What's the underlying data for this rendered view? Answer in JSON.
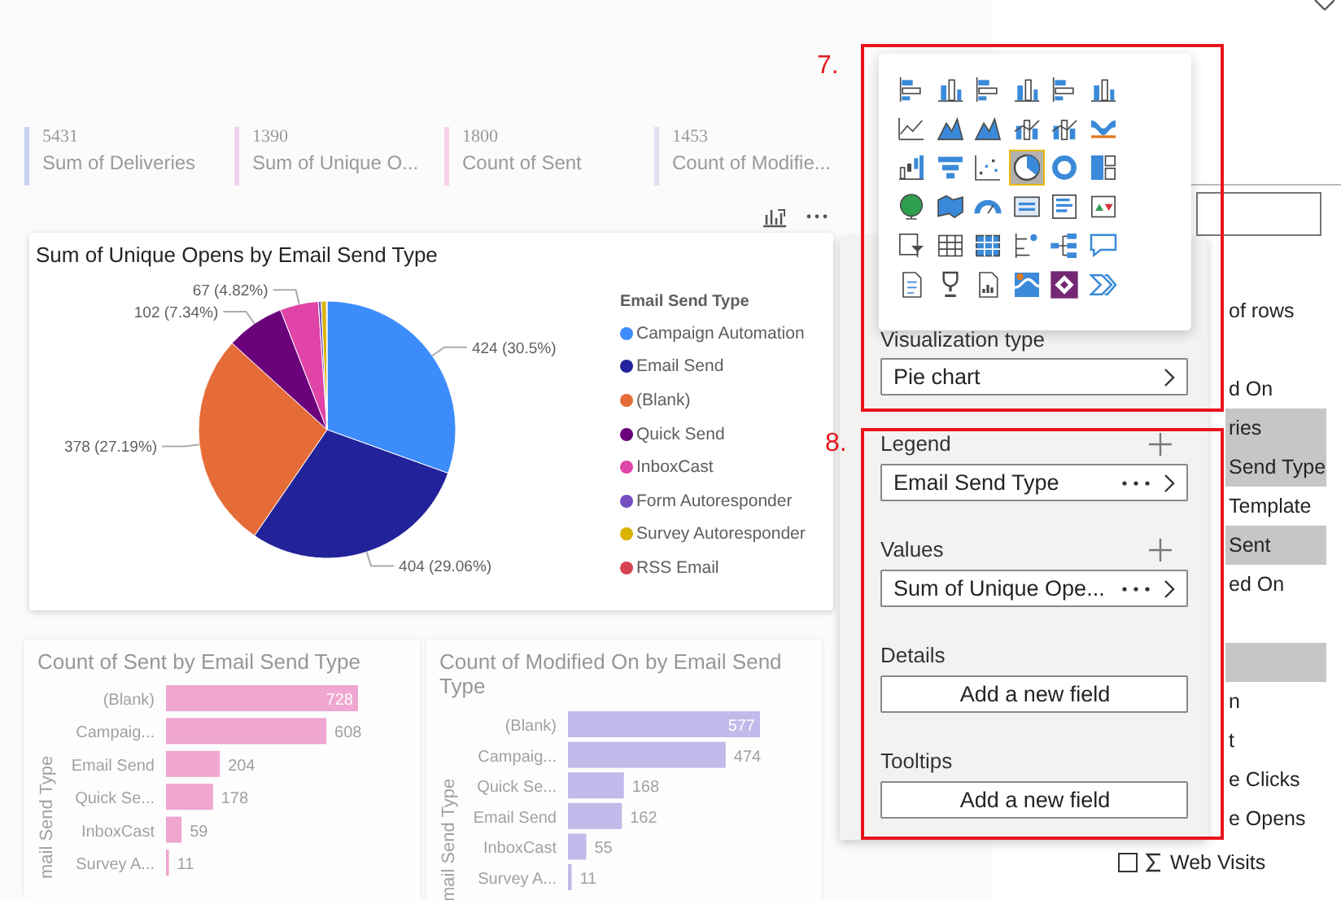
{
  "kpi_cards": [
    {
      "value": "5431",
      "label": "Sum of Deliveries",
      "color": "#c9d0f2"
    },
    {
      "value": "1390",
      "label": "Sum of Unique O...",
      "color": "#eed3ee"
    },
    {
      "value": "1800",
      "label": "Count of Sent",
      "color": "#f7d2e6"
    },
    {
      "value": "1453",
      "label": "Count of Modifie...",
      "color": "#e2def4"
    }
  ],
  "pie_card": {
    "title": "Sum of Unique Opens by Email Send Type",
    "legend_title": "Email Send Type",
    "legend": [
      {
        "label": "Campaign Automation",
        "color": "#3c8cfc"
      },
      {
        "label": "Email Send",
        "color": "#22239a"
      },
      {
        "label": "(Blank)",
        "color": "#e66c37"
      },
      {
        "label": "Quick Send",
        "color": "#6b007b"
      },
      {
        "label": "InboxCast",
        "color": "#e044a7"
      },
      {
        "label": "Form Autoresponder",
        "color": "#744ec2"
      },
      {
        "label": "Survey Autoresponder",
        "color": "#d9b300"
      },
      {
        "label": "RSS Email",
        "color": "#d64550"
      }
    ],
    "chart_data": {
      "type": "pie",
      "series": [
        {
          "values": [
            30.5,
            29.06,
            27.19,
            7.34,
            4.82,
            0.36,
            0.65,
            0.08
          ]
        }
      ],
      "value_labels": [
        "424 (30.5%)",
        "404 (29.06%)",
        "378 (27.19%)",
        "102 (7.34%)",
        "67 (4.82%)",
        null,
        null,
        null
      ]
    }
  },
  "bar_cards": [
    {
      "title": "Count of Sent by Email Send Type",
      "chart_data": {
        "type": "bar",
        "orientation": "horizontal",
        "ylabel": "mail Send Type",
        "categories": [
          "(Blank)",
          "Campaig...",
          "Email Send",
          "Quick Se...",
          "InboxCast",
          "Survey A..."
        ],
        "series": [
          {
            "color": "#e86fb4",
            "values": [
              728,
              608,
              204,
              178,
              59,
              11
            ]
          }
        ],
        "data_labels": true
      }
    },
    {
      "title": "Count of Modified On by Email Send Type",
      "chart_data": {
        "type": "bar",
        "orientation": "horizontal",
        "ylabel": "mail Send Type",
        "categories": [
          "(Blank)",
          "Campaig...",
          "Quick Se...",
          "Email Send",
          "InboxCast",
          "Survey A..."
        ],
        "series": [
          {
            "color": "#9d8fe0",
            "values": [
              577,
              474,
              168,
              162,
              55,
              11
            ]
          }
        ],
        "data_labels": true
      }
    }
  ],
  "field_list": [
    {
      "label": "of rows",
      "selected": false,
      "kind": "partial"
    },
    {
      "label": "d On",
      "selected": false,
      "kind": "partial"
    },
    {
      "label": "ries",
      "selected": true,
      "kind": "partial"
    },
    {
      "label": "Send Type",
      "selected": true,
      "kind": "partial"
    },
    {
      "label": "Template",
      "selected": false,
      "kind": "partial"
    },
    {
      "label": "Sent",
      "selected": true,
      "kind": "partial"
    },
    {
      "label": "ed On",
      "selected": false,
      "kind": "partial"
    },
    {
      "selected": true,
      "kind": "partial"
    },
    {
      "label": "n",
      "selected": false,
      "kind": "partial"
    },
    {
      "label": "t",
      "selected": false,
      "kind": "partial"
    },
    {
      "label": "e Clicks",
      "selected": false,
      "kind": "partial"
    },
    {
      "label": "e Opens",
      "selected": false,
      "kind": "partial"
    },
    {
      "label": "Web Visits",
      "selected": false,
      "kind": "measure"
    }
  ],
  "visual_types": [
    {
      "kind": "stacked-bar",
      "selected": false
    },
    {
      "kind": "stacked-column",
      "selected": false
    },
    {
      "kind": "clustered-bar",
      "selected": false
    },
    {
      "kind": "clustered-column",
      "selected": false
    },
    {
      "kind": "percent-bar",
      "selected": false
    },
    {
      "kind": "percent-column",
      "selected": false
    },
    {
      "kind": "line",
      "selected": false
    },
    {
      "kind": "area",
      "selected": false
    },
    {
      "kind": "stacked-area",
      "selected": false
    },
    {
      "kind": "line-column",
      "selected": false
    },
    {
      "kind": "line-clustered-column",
      "selected": false
    },
    {
      "kind": "ribbon",
      "selected": false
    },
    {
      "kind": "waterfall",
      "selected": false
    },
    {
      "kind": "funnel",
      "selected": false
    },
    {
      "kind": "scatter",
      "selected": false
    },
    {
      "kind": "pie",
      "selected": true
    },
    {
      "kind": "donut",
      "selected": false
    },
    {
      "kind": "treemap",
      "selected": false
    },
    {
      "kind": "map",
      "selected": false
    },
    {
      "kind": "filled-map",
      "selected": false
    },
    {
      "kind": "gauge",
      "selected": false
    },
    {
      "kind": "card",
      "selected": false
    },
    {
      "kind": "multi-row-card",
      "selected": false
    },
    {
      "kind": "kpi",
      "selected": false
    },
    {
      "kind": "slicer",
      "selected": false
    },
    {
      "kind": "table",
      "selected": false
    },
    {
      "kind": "matrix",
      "selected": false
    },
    {
      "kind": "key-influencers",
      "selected": false
    },
    {
      "kind": "decomposition-tree",
      "selected": false
    },
    {
      "kind": "qa",
      "selected": false
    },
    {
      "kind": "smart-narrative",
      "selected": false
    },
    {
      "kind": "goals",
      "selected": false
    },
    {
      "kind": "paginated-report",
      "selected": false
    },
    {
      "kind": "azure-map",
      "selected": false
    },
    {
      "kind": "power-apps",
      "selected": false
    },
    {
      "kind": "power-automate",
      "selected": false
    }
  ],
  "viz_pane": {
    "type_label": "Visualization type",
    "visual_type": "Pie chart",
    "wells": [
      {
        "label": "Legend",
        "kind": "field",
        "value": "Email Send Type"
      },
      {
        "label": "Values",
        "kind": "field",
        "value": "Sum of Unique Ope..."
      },
      {
        "label": "Details",
        "kind": "empty",
        "value": "Add a new field"
      },
      {
        "label": "Tooltips",
        "kind": "empty",
        "value": "Add a new field"
      }
    ]
  },
  "annotations": [
    {
      "label": "7."
    },
    {
      "label": "8."
    }
  ]
}
